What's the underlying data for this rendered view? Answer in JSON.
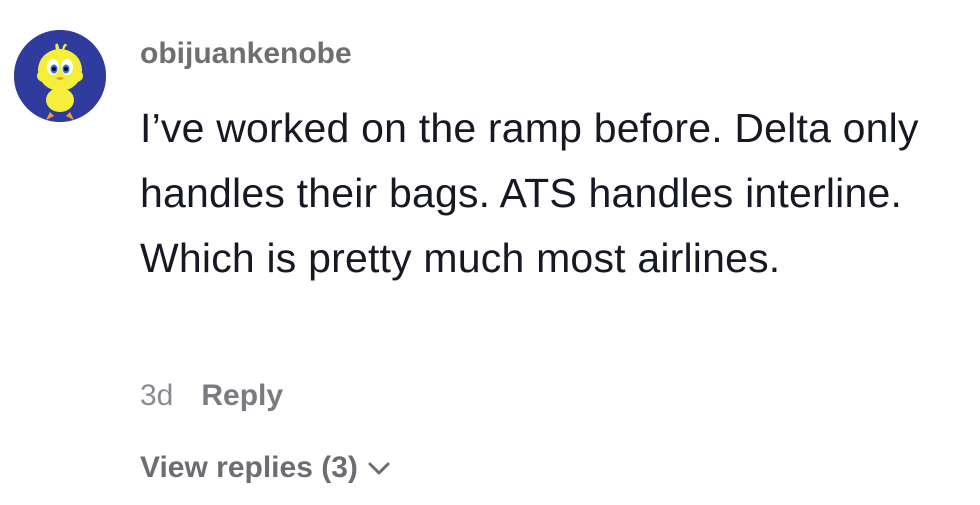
{
  "comment": {
    "avatar_icon": "tweety-bird-avatar",
    "username": "obijuankenobe",
    "text": "I’ve worked on the ramp before. Delta only handles their bags. ATS handles interline. Which is pretty much most airlines.",
    "timestamp": "3d",
    "reply_label": "Reply",
    "view_replies_label": "View replies (3)",
    "chevron_icon": "chevron-down-icon"
  },
  "colors": {
    "avatar_bg": "#2f3c9e",
    "text": "#161823",
    "secondary": "#6f6f72"
  }
}
